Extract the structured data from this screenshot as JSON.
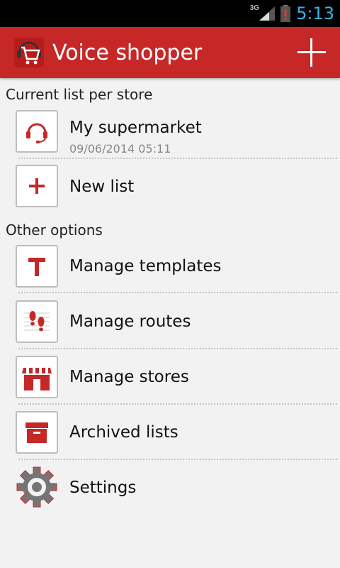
{
  "status": {
    "network": "3G",
    "time": "5:13"
  },
  "appbar": {
    "title": "Voice shopper",
    "add_icon": "plus-icon"
  },
  "sections": {
    "current": "Current list per store",
    "other": "Other options"
  },
  "lists": [
    {
      "title": "My supermarket",
      "subtitle": "09/06/2014 05:11",
      "icon": "headset-icon"
    },
    {
      "title": "New list",
      "icon": "plus-icon"
    }
  ],
  "options": [
    {
      "label": "Manage templates",
      "icon": "template-icon"
    },
    {
      "label": "Manage routes",
      "icon": "footsteps-icon"
    },
    {
      "label": "Manage stores",
      "icon": "store-icon"
    },
    {
      "label": "Archived lists",
      "icon": "archive-box-icon"
    },
    {
      "label": "Settings",
      "icon": "gear-icon"
    }
  ],
  "colors": {
    "accent": "#c62828",
    "clock": "#33b5e5",
    "background": "#f2f2f2"
  }
}
